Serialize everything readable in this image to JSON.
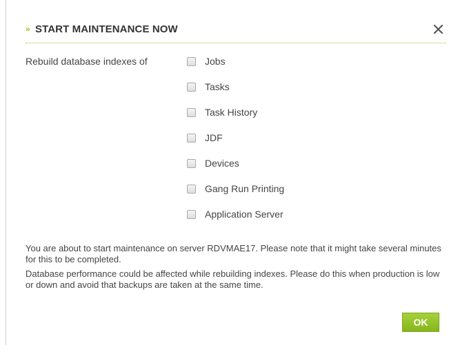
{
  "dialog": {
    "title_chevron": "»",
    "title": "START MAINTENANCE NOW",
    "close_icon": "close-icon"
  },
  "rebuild": {
    "label": "Rebuild database indexes of",
    "options": [
      {
        "label": "Jobs",
        "checked": false
      },
      {
        "label": "Tasks",
        "checked": false
      },
      {
        "label": "Task History",
        "checked": false
      },
      {
        "label": "JDF",
        "checked": false
      },
      {
        "label": "Devices",
        "checked": false
      },
      {
        "label": "Gang Run Printing",
        "checked": false
      },
      {
        "label": "Application Server",
        "checked": false
      }
    ]
  },
  "message": {
    "line1": "You are about to start maintenance on server RDVMAE17. Please note that it might take several minutes for this to be completed.",
    "line2": "Database performance could be affected while rebuilding indexes. Please do this when production is low or down and avoid that backups are taken at the same time."
  },
  "footer": {
    "ok_label": "OK"
  },
  "colors": {
    "accent": "#9ec62a",
    "ok_button": "#96c32a",
    "text": "#444444",
    "title_text": "#333333"
  }
}
